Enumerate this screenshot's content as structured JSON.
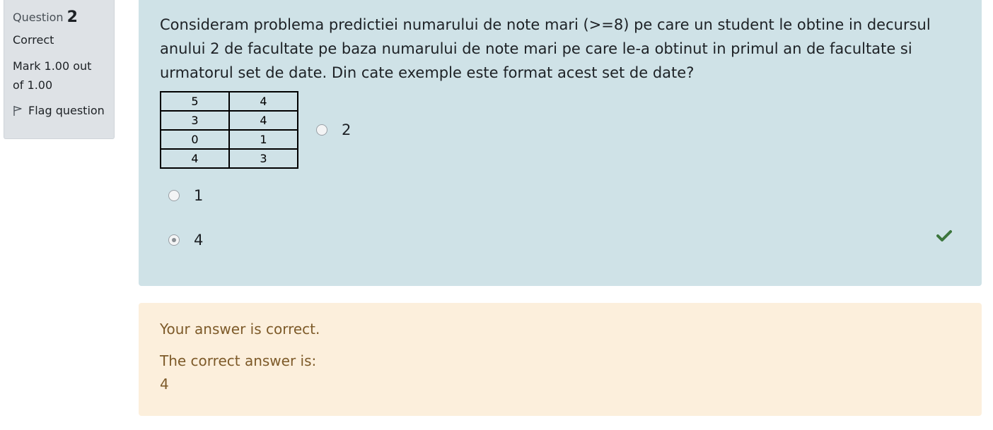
{
  "info": {
    "question_label": "Question",
    "question_number": "2",
    "state": "Correct",
    "grade": "Mark 1.00 out of 1.00",
    "flag_label": "Flag question"
  },
  "question": {
    "text": "Consideram problema predictiei numarului de note mari (>=8) pe care un student le obtine in decursul anului 2 de facultate pe baza numarului de note mari pe care le-a obtinut in primul an de facultate si urmatorul set de date. Din cate exemple este format acest set de date?",
    "table": [
      [
        "5",
        "4"
      ],
      [
        "3",
        "4"
      ],
      [
        "0",
        "1"
      ],
      [
        "4",
        "3"
      ]
    ],
    "options": [
      {
        "label": "2",
        "checked": false
      },
      {
        "label": "1",
        "checked": false
      },
      {
        "label": "4",
        "checked": true
      }
    ],
    "correct_icon": "checkmark-icon"
  },
  "feedback": {
    "status": "Your answer is correct.",
    "correct_label": "The correct answer is:",
    "correct_value": "4"
  },
  "colors": {
    "question_bg": "#cfe2e7",
    "feedback_bg": "#fcefdc",
    "feedback_text": "#7d5a29",
    "correct_green": "#3c763d"
  }
}
